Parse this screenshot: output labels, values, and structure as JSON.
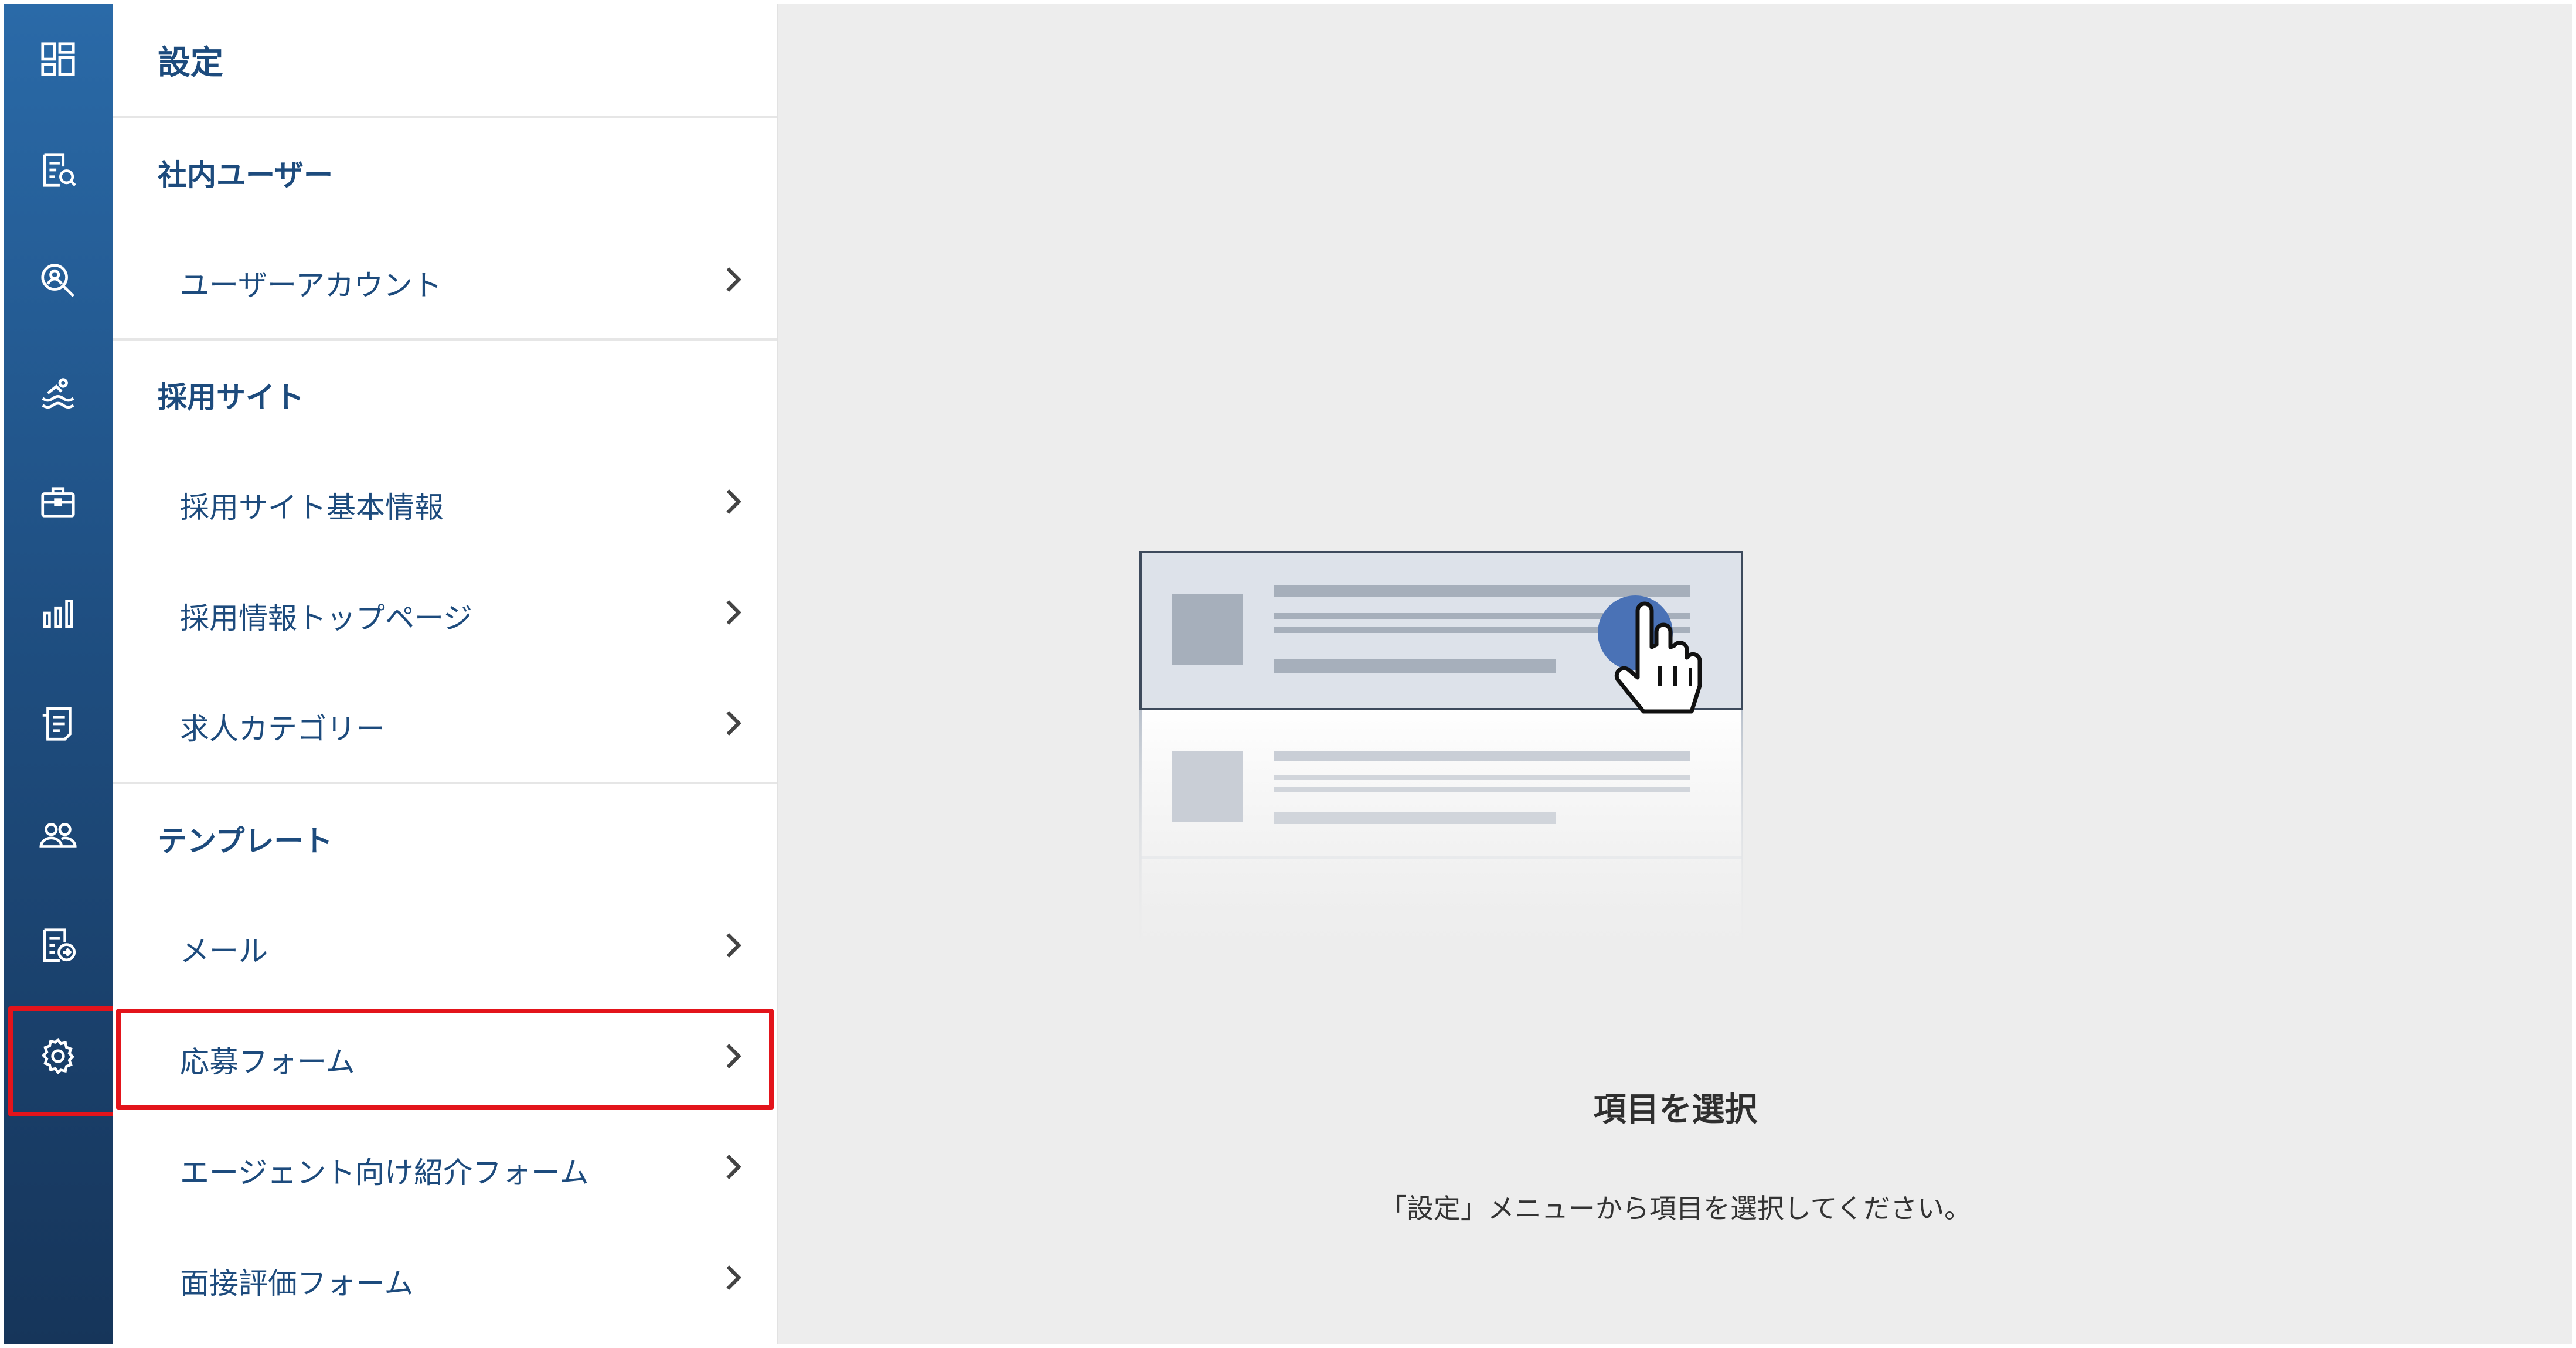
{
  "rail": {
    "items": [
      {
        "icon": "dashboard-icon"
      },
      {
        "icon": "document-search-icon"
      },
      {
        "icon": "candidate-search-icon"
      },
      {
        "icon": "swimmer-icon"
      },
      {
        "icon": "briefcase-icon"
      },
      {
        "icon": "bar-chart-icon"
      },
      {
        "icon": "receipt-icon"
      },
      {
        "icon": "users-icon"
      },
      {
        "icon": "document-export-icon"
      },
      {
        "icon": "gear-icon"
      }
    ]
  },
  "menu": {
    "title": "設定",
    "sections": [
      {
        "title": "社内ユーザー",
        "items": [
          "ユーザーアカウント"
        ]
      },
      {
        "title": "採用サイト",
        "items": [
          "採用サイト基本情報",
          "採用情報トップページ",
          "求人カテゴリー"
        ]
      },
      {
        "title": "テンプレート",
        "items": [
          "メール",
          "応募フォーム",
          "エージェント向け紹介フォーム",
          "面接評価フォーム"
        ]
      }
    ]
  },
  "empty_state": {
    "title": "項目を選択",
    "description": "「設定」メニューから項目を選択してください。"
  },
  "colors": {
    "accent": "#1d4b7d",
    "highlight": "#e3141b",
    "rail_top": "#2a6aa8",
    "rail_bottom": "#16355a"
  }
}
